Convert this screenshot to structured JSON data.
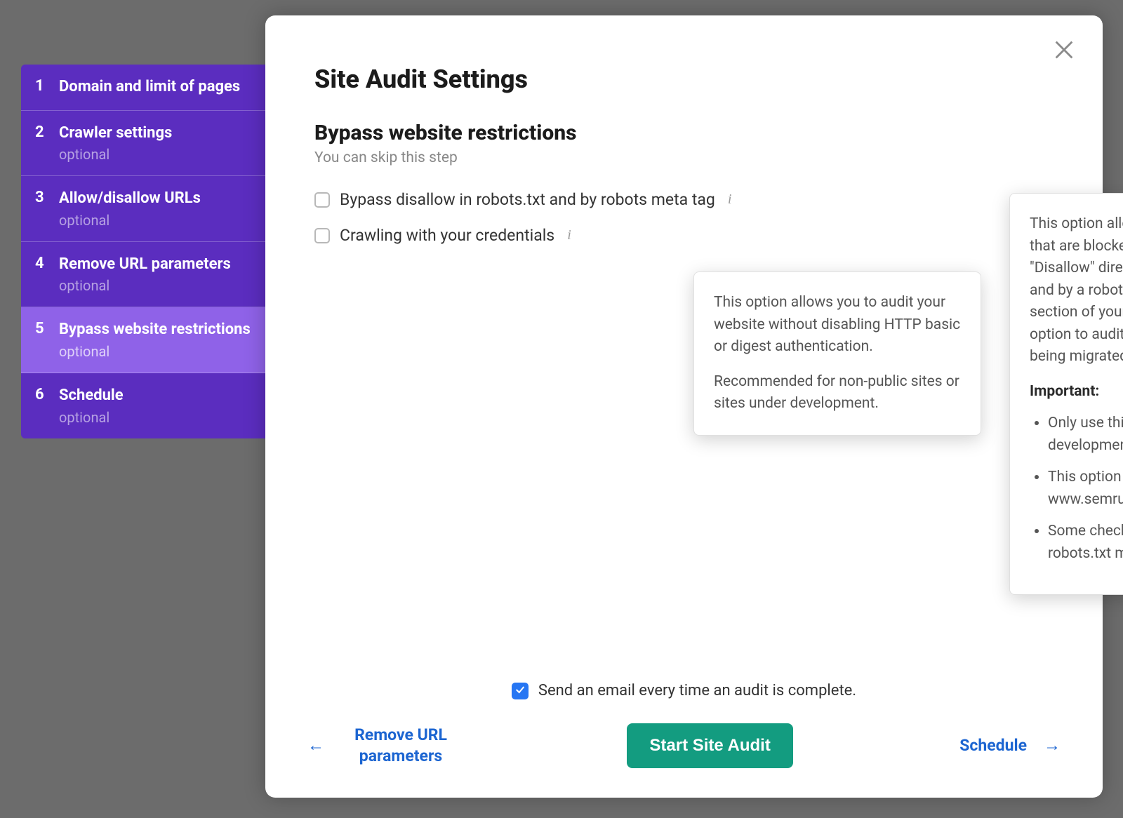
{
  "sidebar": {
    "steps": [
      {
        "num": "1",
        "title": "Domain and limit of pages",
        "sub": ""
      },
      {
        "num": "2",
        "title": "Crawler settings",
        "sub": "optional"
      },
      {
        "num": "3",
        "title": "Allow/disallow URLs",
        "sub": "optional"
      },
      {
        "num": "4",
        "title": "Remove URL parameters",
        "sub": "optional"
      },
      {
        "num": "5",
        "title": "Bypass website restrictions",
        "sub": "optional"
      },
      {
        "num": "6",
        "title": "Schedule",
        "sub": "optional"
      }
    ],
    "active_index": 4
  },
  "panel": {
    "title": "Site Audit Settings",
    "section_title": "Bypass website restrictions",
    "section_sub": "You can skip this step",
    "option1": "Bypass disallow in robots.txt and by robots meta tag",
    "option2": "Crawling with your credentials"
  },
  "tooltip_credentials": {
    "p1": "This option allows you to audit your website without disabling HTTP basic or digest authentication.",
    "p2": "Recommended for non-public sites or sites under development."
  },
  "tooltip_robots": {
    "p1": "This option allows you to audit pages that are blocked from crawling by a \"Disallow\" directive in your robots.txt file and by a robots meta tag in the <head> section of your page. You can use this option to audit all pages of the site being migrated.",
    "important_label": "Important:",
    "bullets": [
      "Only use this option for sites under development",
      "This option will affect all www.semrush.com subdomains",
      "Some checks regarding your robots.txt may not be triggered"
    ]
  },
  "footer": {
    "email_label": "Send an email every time an audit is complete.",
    "back_label": "Remove URL parameters",
    "start_label": "Start Site Audit",
    "next_label": "Schedule"
  }
}
